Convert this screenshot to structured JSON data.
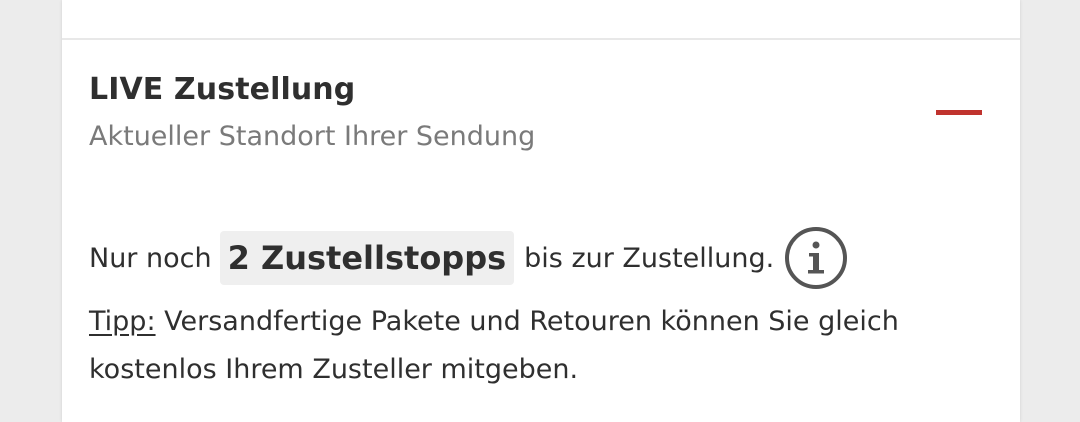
{
  "live_section": {
    "title": "LIVE Zustellung",
    "subtitle": "Aktueller Standort Ihrer Sendung",
    "accent_color": "#c0332e",
    "collapse_icon": "minus-icon",
    "stops": {
      "prefix": "Nur noch",
      "highlight": "2 Zustellstopps",
      "suffix": "bis zur Zustellung.",
      "info_icon": "info-icon"
    },
    "tip": {
      "label": "Tipp:",
      "text": "Versandfertige Pakete und Retouren können Sie gleich kostenlos Ihrem Zusteller mitgeben."
    }
  }
}
